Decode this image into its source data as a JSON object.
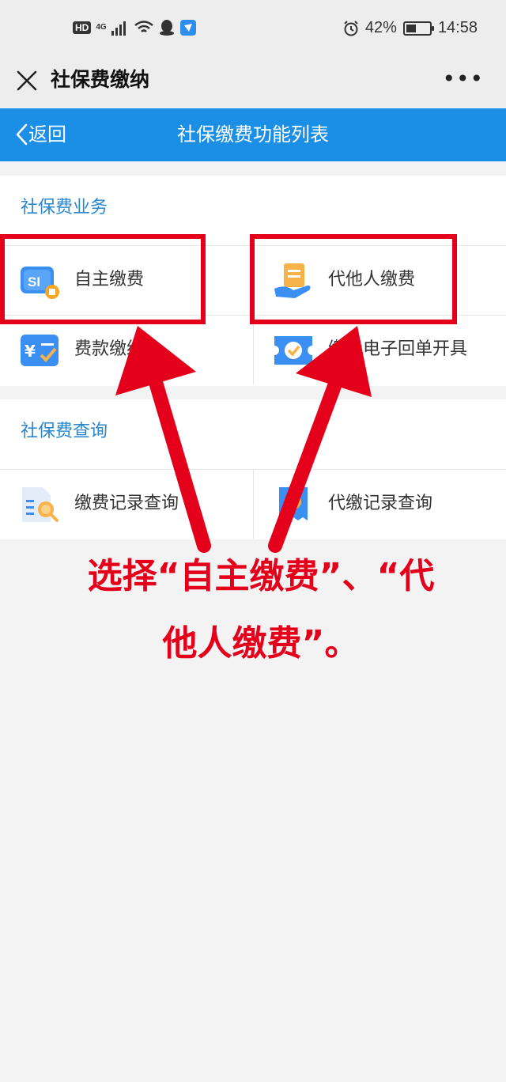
{
  "status_bar": {
    "hd": "HD",
    "net": "4G",
    "battery_pct": "42%",
    "battery_level": 0.42,
    "time": "14:58",
    "icons": [
      "signal-icon",
      "wifi-icon",
      "qq-icon",
      "app-icon",
      "alarm-icon",
      "battery-icon"
    ]
  },
  "nav": {
    "title": "社保费缴纳",
    "more": "•••"
  },
  "header": {
    "back_label": "返回",
    "title": "社保缴费功能列表",
    "color": "#1b8ee6"
  },
  "sections": [
    {
      "title": "社保费业务",
      "items": [
        {
          "label": "自主缴费",
          "icon": "social-security-card-icon"
        },
        {
          "label": "代他人缴费",
          "icon": "pay-for-others-icon"
        },
        {
          "label": "费款缴纳",
          "icon": "fee-payment-icon"
        },
        {
          "label": "缴费电子回单开具",
          "icon": "e-receipt-icon"
        }
      ]
    },
    {
      "title": "社保费查询",
      "items": [
        {
          "label": "缴费记录查询",
          "icon": "record-search-icon"
        },
        {
          "label": "代缴记录查询",
          "icon": "proxy-record-icon"
        }
      ]
    }
  ],
  "annotation": {
    "line1": "选择“自主缴费”、“代",
    "line2": "他人缴费”。",
    "color": "#e4001b"
  }
}
